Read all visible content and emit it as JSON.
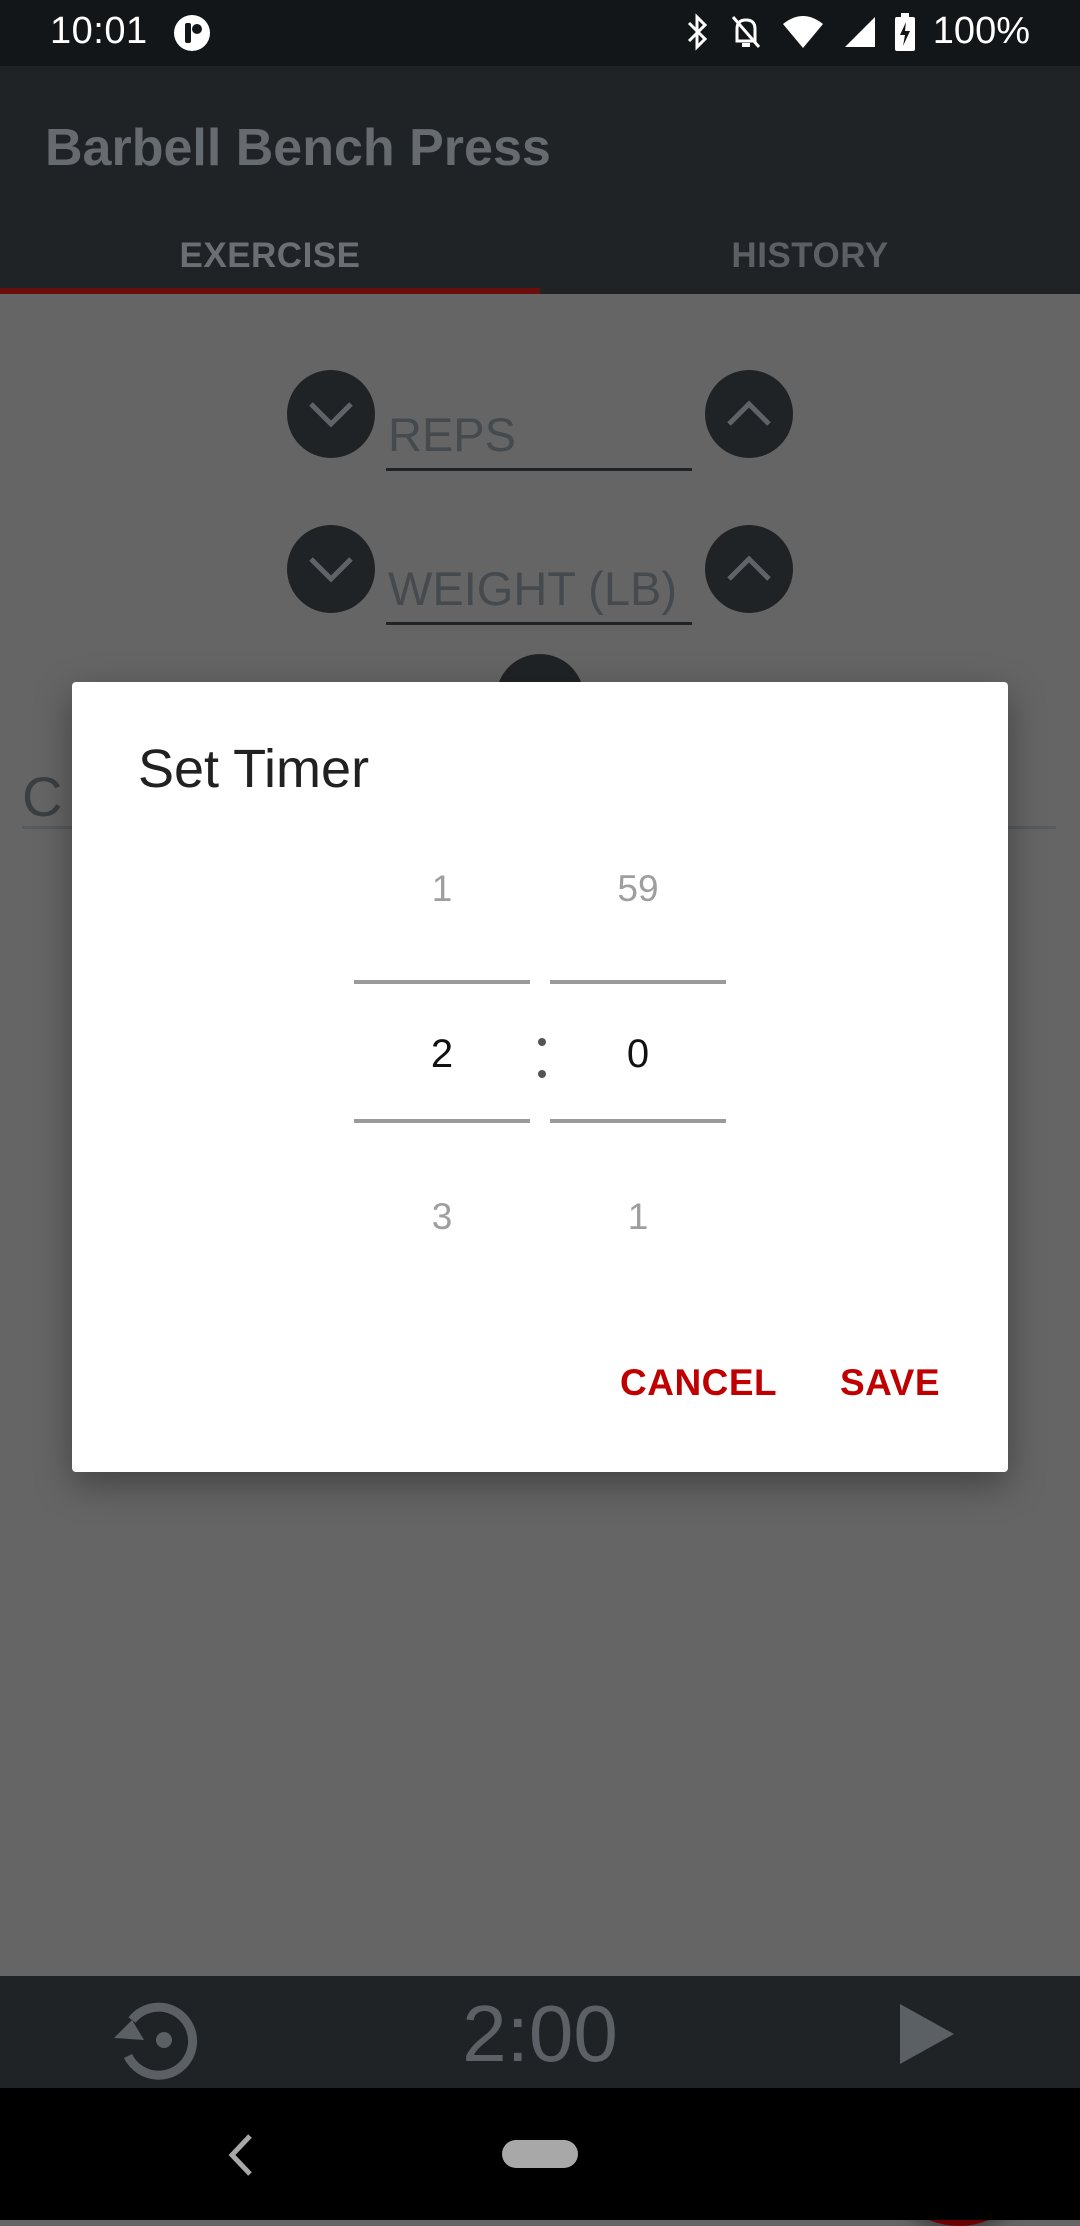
{
  "status_bar": {
    "time": "10:01",
    "battery_text": "100%",
    "icons": [
      "app-notification-icon",
      "bluetooth-icon",
      "notifications-off-icon",
      "wifi-icon",
      "cell-signal-icon",
      "battery-charging-icon"
    ]
  },
  "app_bar": {
    "title": "Barbell Bench Press",
    "tabs": [
      {
        "label": "EXERCISE",
        "selected": true
      },
      {
        "label": "HISTORY",
        "selected": false
      }
    ]
  },
  "exercise_form": {
    "reps_placeholder": "REPS",
    "weight_placeholder": "WEIGHT (LB)",
    "notes_partial_text": "C"
  },
  "dialog": {
    "title": "Set Timer",
    "minutes": {
      "previous": "1",
      "current": "2",
      "next": "3"
    },
    "separator": ":",
    "seconds": {
      "previous": "59",
      "current": "0",
      "next": "1"
    },
    "cancel_label": "CANCEL",
    "save_label": "SAVE"
  },
  "timer_bar": {
    "display": "2:00"
  },
  "colors": {
    "accent": "#c00000",
    "app_bar_bg": "#1f2326",
    "scrim_bg": "#656565",
    "fab_bg": "#6b0000"
  }
}
